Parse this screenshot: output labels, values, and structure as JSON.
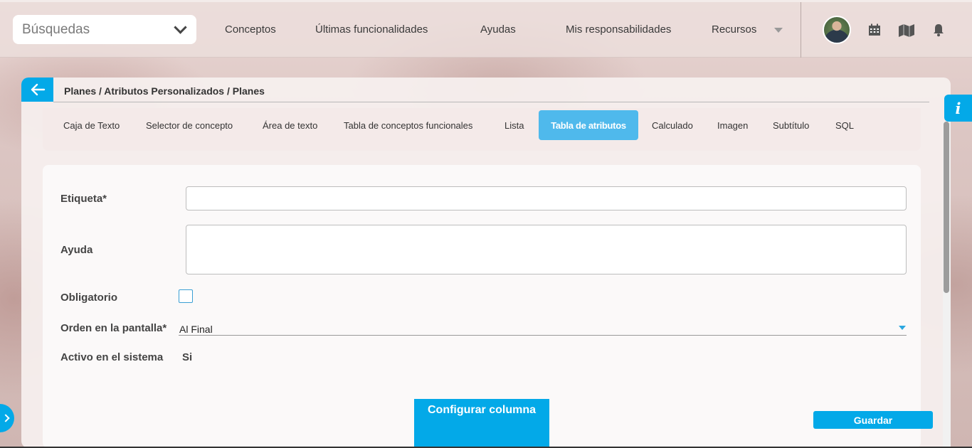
{
  "header": {
    "search_placeholder": "Búsquedas",
    "nav": [
      "Conceptos",
      "Últimas funcionalidades",
      "Ayudas",
      "Mis responsabilidades",
      "Recursos"
    ]
  },
  "breadcrumb": "Planes / Atributos Personalizados / Planes",
  "tabs": [
    "Caja de Texto",
    "Selector de concepto",
    "Área de texto",
    "Tabla de conceptos funcionales",
    "Lista",
    "Tabla de atributos",
    "Calculado",
    "Imagen",
    "Subtítulo",
    "SQL"
  ],
  "active_tab": "Tabla de atributos",
  "form": {
    "label_field": "Etiqueta*",
    "label_value": "",
    "help_field": "Ayuda",
    "help_value": "",
    "required_field": "Obligatorio",
    "required_checked": false,
    "order_field": "Orden en la pantalla*",
    "order_value": "Al Final",
    "active_field": "Activo en el sistema",
    "active_value": "Si"
  },
  "buttons": {
    "configure": "Configurar columna",
    "save": "Guardar"
  },
  "info_label": "i",
  "colors": {
    "accent": "#03a9e8",
    "active_tab": "#4fb9ec"
  },
  "scrollbar": {
    "thumb_fraction": 0.53
  }
}
